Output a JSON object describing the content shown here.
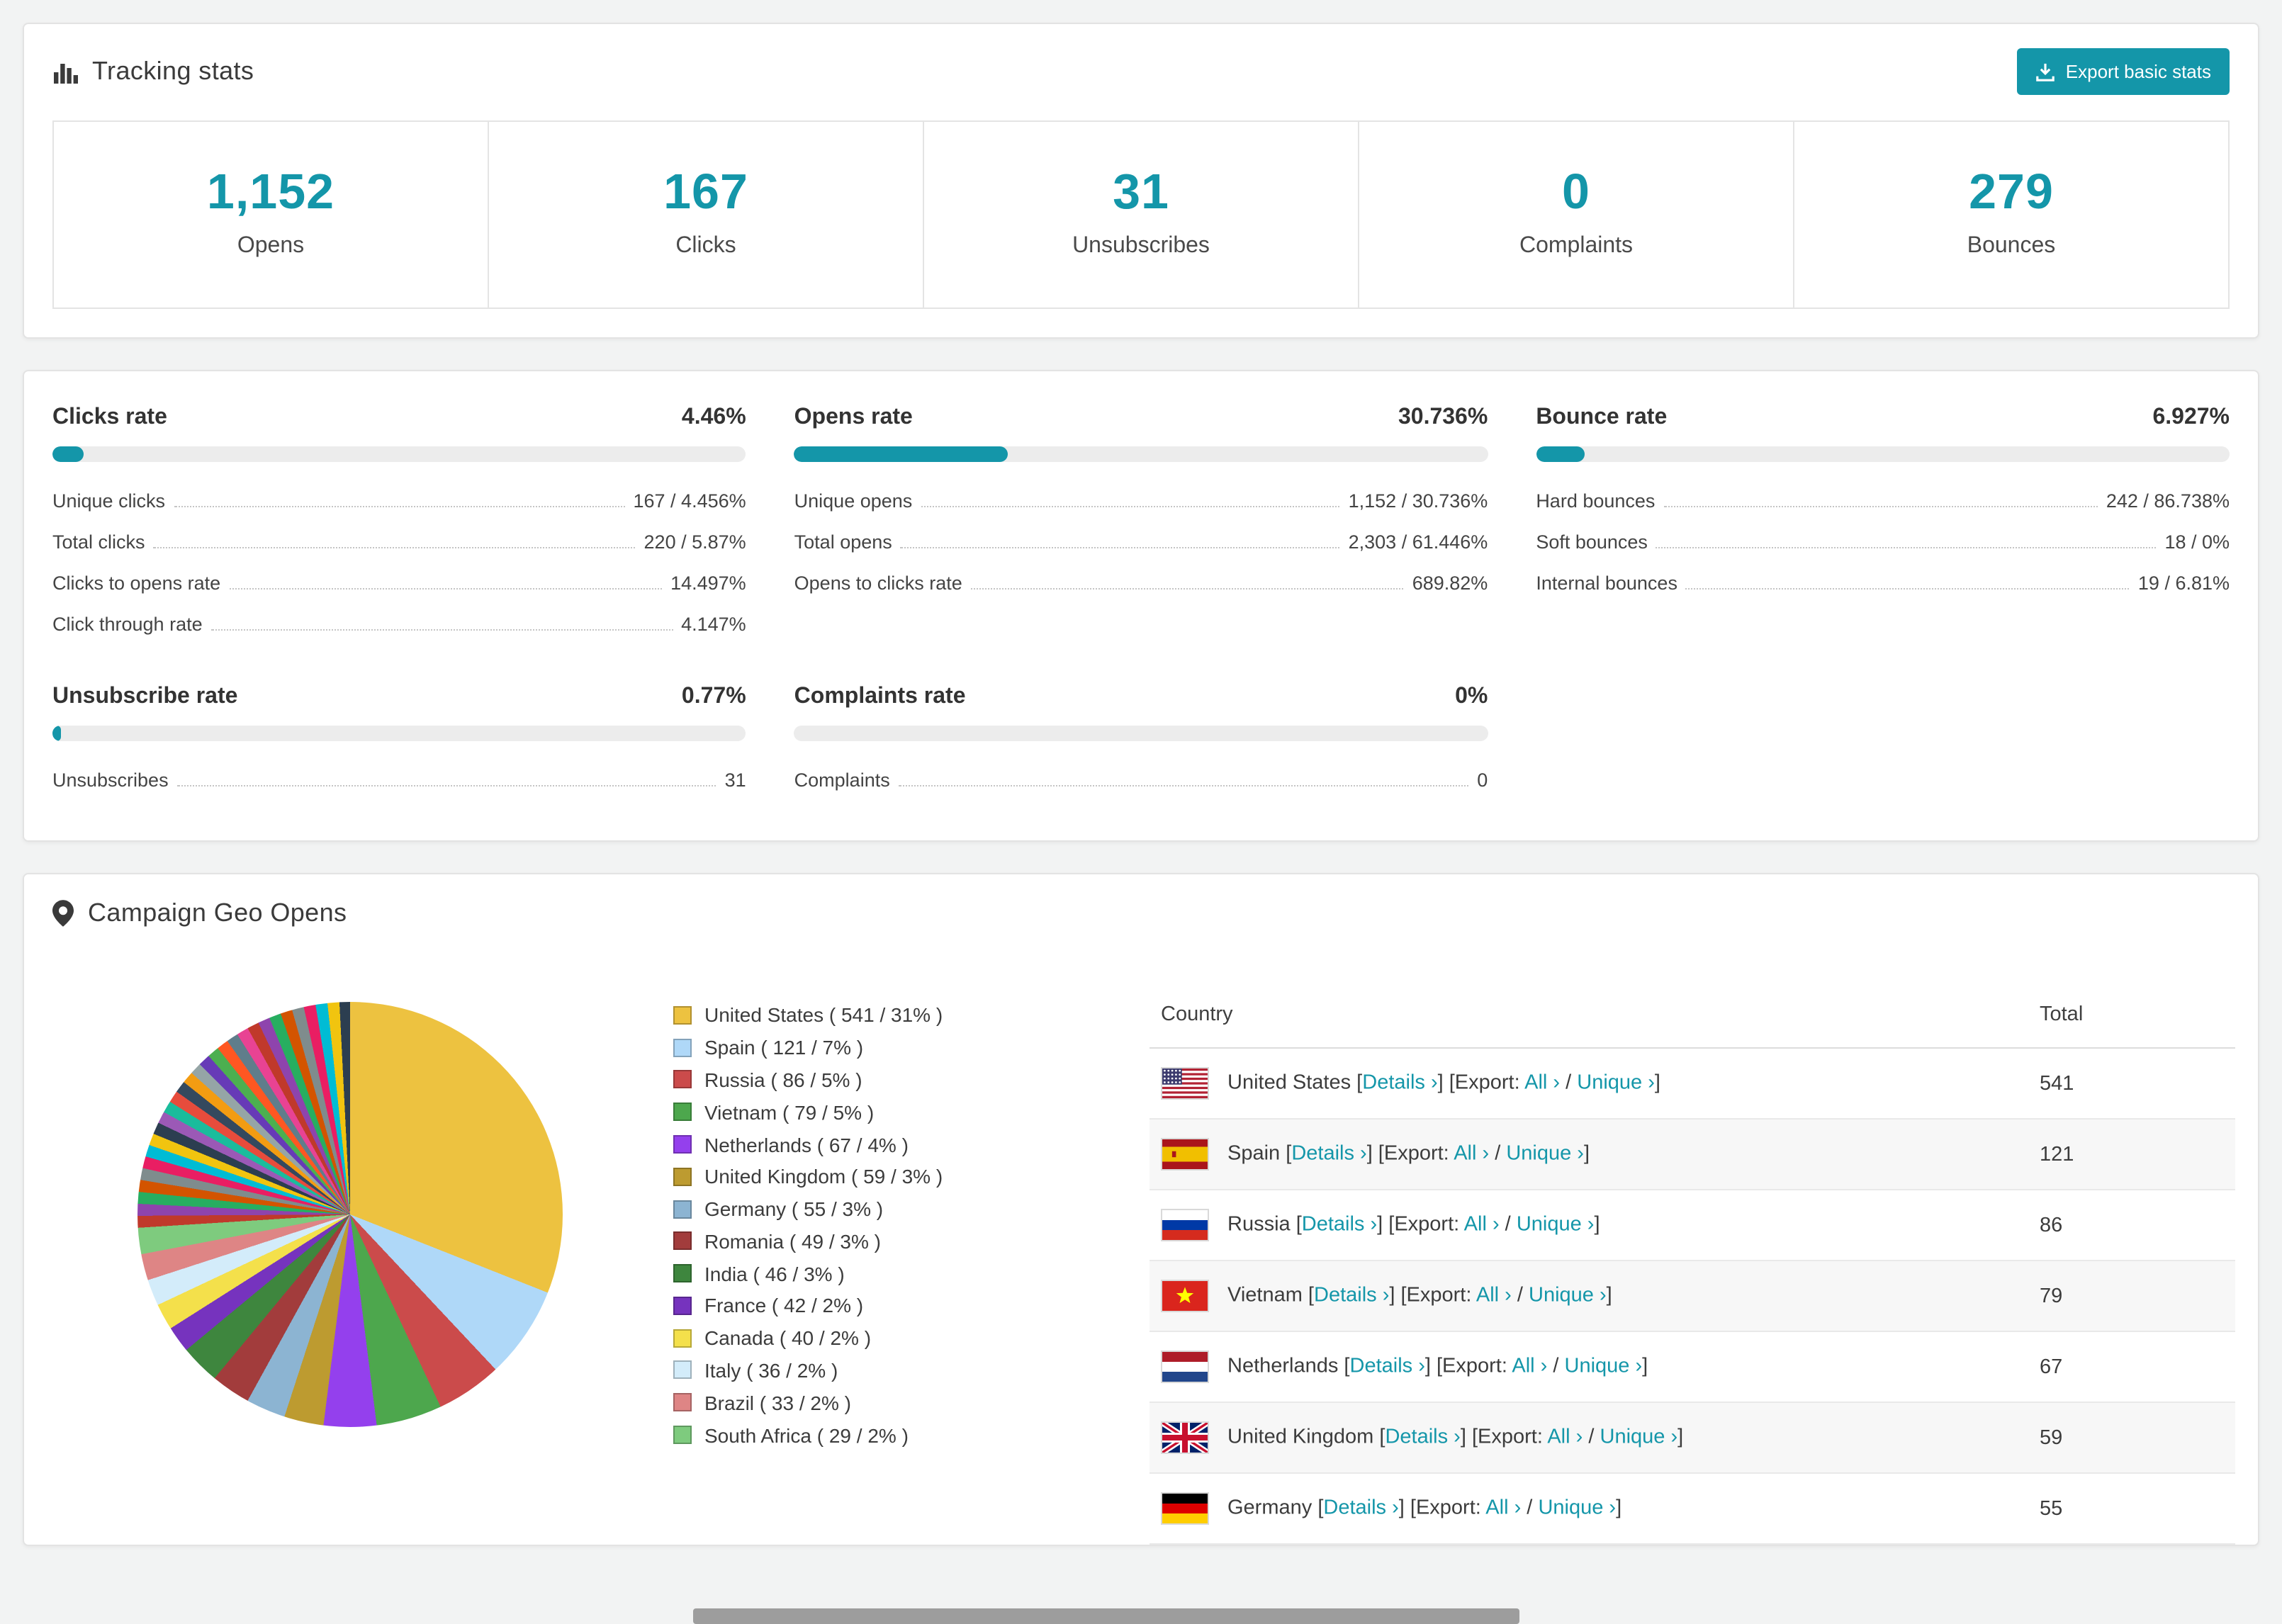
{
  "colors": {
    "accent": "#1496a9"
  },
  "tracking": {
    "title": "Tracking stats",
    "export_button": "Export basic stats",
    "stats": [
      {
        "value": "1,152",
        "label": "Opens"
      },
      {
        "value": "167",
        "label": "Clicks"
      },
      {
        "value": "31",
        "label": "Unsubscribes"
      },
      {
        "value": "0",
        "label": "Complaints"
      },
      {
        "value": "279",
        "label": "Bounces"
      }
    ]
  },
  "rates": [
    {
      "title": "Clicks rate",
      "percent_label": "4.46%",
      "percent": 4.46,
      "rows": [
        {
          "label": "Unique clicks",
          "value": "167 / 4.456%"
        },
        {
          "label": "Total clicks",
          "value": "220 / 5.87%"
        },
        {
          "label": "Clicks to opens rate",
          "value": "14.497%"
        },
        {
          "label": "Click through rate",
          "value": "4.147%"
        }
      ]
    },
    {
      "title": "Opens rate",
      "percent_label": "30.736%",
      "percent": 30.736,
      "rows": [
        {
          "label": "Unique opens",
          "value": "1,152 / 30.736%"
        },
        {
          "label": "Total opens",
          "value": "2,303 / 61.446%"
        },
        {
          "label": "Opens to clicks rate",
          "value": "689.82%"
        }
      ]
    },
    {
      "title": "Bounce rate",
      "percent_label": "6.927%",
      "percent": 6.927,
      "rows": [
        {
          "label": "Hard bounces",
          "value": "242 / 86.738%"
        },
        {
          "label": "Soft bounces",
          "value": "18 / 0%"
        },
        {
          "label": "Internal bounces",
          "value": "19 / 6.81%"
        }
      ]
    },
    {
      "title": "Unsubscribe rate",
      "percent_label": "0.77%",
      "percent": 0.77,
      "rows": [
        {
          "label": "Unsubscribes",
          "value": "31"
        }
      ]
    },
    {
      "title": "Complaints rate",
      "percent_label": "0%",
      "percent": 0,
      "rows": [
        {
          "label": "Complaints",
          "value": "0"
        }
      ]
    }
  ],
  "geo": {
    "title": "Campaign Geo Opens",
    "table": {
      "country_header": "Country",
      "total_header": "Total",
      "details_label": "Details ›",
      "export_prefix": "Export:",
      "all_label": "All ›",
      "unique_label": "Unique ›",
      "bracket_open": "[",
      "bracket_close": "]",
      "separator": "/",
      "rows": [
        {
          "country": "United States",
          "flag": "us",
          "total": "541"
        },
        {
          "country": "Spain",
          "flag": "es",
          "total": "121"
        },
        {
          "country": "Russia",
          "flag": "ru",
          "total": "86"
        },
        {
          "country": "Vietnam",
          "flag": "vn",
          "total": "79"
        },
        {
          "country": "Netherlands",
          "flag": "nl",
          "total": "67"
        },
        {
          "country": "United Kingdom",
          "flag": "gb",
          "total": "59"
        },
        {
          "country": "Germany",
          "flag": "de",
          "total": "55"
        }
      ]
    }
  },
  "chart_data": {
    "type": "pie",
    "title": "Campaign Geo Opens",
    "legend_position": "right",
    "slices": [
      {
        "label": "United States",
        "value": 541,
        "percent": 31,
        "color": "#edc240"
      },
      {
        "label": "Spain",
        "value": 121,
        "percent": 7,
        "color": "#afd8f8"
      },
      {
        "label": "Russia",
        "value": 86,
        "percent": 5,
        "color": "#cb4b4b"
      },
      {
        "label": "Vietnam",
        "value": 79,
        "percent": 5,
        "color": "#4da74d"
      },
      {
        "label": "Netherlands",
        "value": 67,
        "percent": 4,
        "color": "#9440ed"
      },
      {
        "label": "United Kingdom",
        "value": 59,
        "percent": 3,
        "color": "#bd9b30"
      },
      {
        "label": "Germany",
        "value": 55,
        "percent": 3,
        "color": "#8cb4d2"
      },
      {
        "label": "Romania",
        "value": 49,
        "percent": 3,
        "color": "#a23c3c"
      },
      {
        "label": "India",
        "value": 46,
        "percent": 3,
        "color": "#3e863e"
      },
      {
        "label": "France",
        "value": 42,
        "percent": 2,
        "color": "#7633be"
      },
      {
        "label": "Canada",
        "value": 40,
        "percent": 2,
        "color": "#f4e04b"
      },
      {
        "label": "Italy",
        "value": 36,
        "percent": 2,
        "color": "#d3ecfa"
      },
      {
        "label": "Brazil",
        "value": 33,
        "percent": 2,
        "color": "#de8585"
      },
      {
        "label": "South Africa",
        "value": 29,
        "percent": 2,
        "color": "#7ecb7e"
      }
    ]
  }
}
